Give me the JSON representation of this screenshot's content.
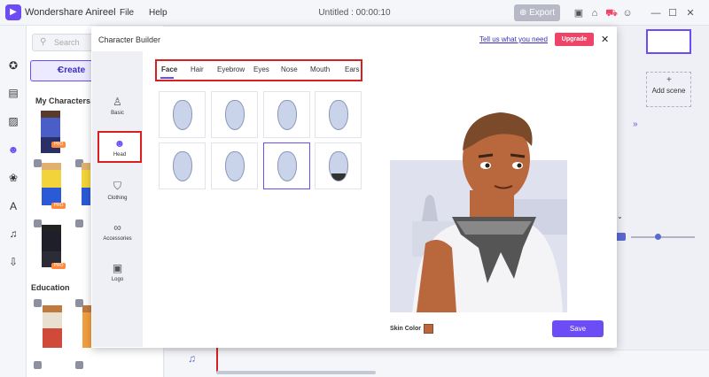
{
  "app": {
    "name": "Wondershare Anireel",
    "menu": [
      "File",
      "Help"
    ],
    "doc_title": "Untitled : 00:00:10",
    "export_label": "Export"
  },
  "library": {
    "search_placeholder": "Search",
    "create_label": "Create",
    "section_my": "My Characters",
    "section_education": "Education",
    "pro_badge": "PRO"
  },
  "right_panel": {
    "add_scene_label": "Add scene"
  },
  "dialog": {
    "title": "Character Builder",
    "feedback_link": "Tell us what you need",
    "upgrade_label": "Upgrade",
    "sidebar": [
      "Basic",
      "Head",
      "Clothing",
      "Accessories",
      "Logo"
    ],
    "subtabs": [
      "Face",
      "Hair",
      "Eyebrow",
      "Eyes",
      "Nose",
      "Mouth",
      "Ears"
    ],
    "skin_color_label": "Skin Color",
    "skin_color": "#b8683c",
    "save_label": "Save"
  },
  "colors": {
    "accent": "#6c4cf5",
    "upgrade": "#ee4466",
    "highlight_box": "#d92020"
  }
}
